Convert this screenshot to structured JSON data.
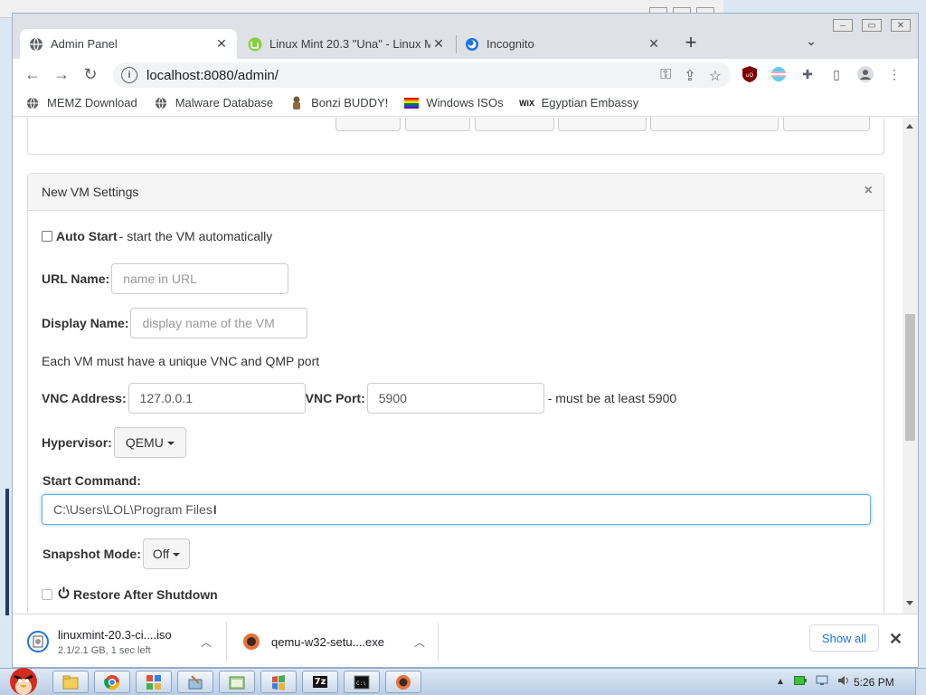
{
  "tabs": [
    {
      "title": "Admin Panel",
      "icon": "globe-icon",
      "active": true
    },
    {
      "title": "Linux Mint 20.3 \"Una\" - Linux M",
      "icon": "linux-mint-icon",
      "active": false
    },
    {
      "title": "Incognito",
      "icon": "incognito-icon",
      "active": false
    }
  ],
  "address_bar": {
    "url": "localhost:8080/admin/"
  },
  "bookmarks": [
    {
      "label": "MEMZ Download",
      "icon": "globe-icon"
    },
    {
      "label": "Malware Database",
      "icon": "globe-icon"
    },
    {
      "label": "Bonzi BUDDY!",
      "icon": "bonzi-icon"
    },
    {
      "label": "Windows ISOs",
      "icon": "rainbow-flag-icon"
    },
    {
      "label": "Egyptian Embassy",
      "icon": "wix-icon"
    }
  ],
  "panel": {
    "title": "New VM Settings",
    "close_glyph": "×",
    "autostart": {
      "label": "Auto Start",
      "desc": "- start the VM automatically",
      "checked": false
    },
    "url_name": {
      "label": "URL Name:",
      "placeholder": "name in URL",
      "value": ""
    },
    "display_name": {
      "label": "Display Name:",
      "placeholder": "display name of the VM",
      "value": ""
    },
    "port_note": "Each VM must have a unique VNC and QMP port",
    "vnc_address": {
      "label": "VNC Address:",
      "value": "127.0.0.1"
    },
    "vnc_port": {
      "label": "VNC Port:",
      "value": "5900",
      "note": "- must be at least 5900"
    },
    "hypervisor": {
      "label": "Hypervisor:",
      "value": "QEMU"
    },
    "start_command": {
      "label": "Start Command:",
      "value": "C:\\Users\\LOL\\Program Files"
    },
    "snapshot_mode": {
      "label": "Snapshot Mode:",
      "value": "Off"
    },
    "restore_after_shutdown": {
      "label": "Restore After Shutdown",
      "checked": false
    }
  },
  "downloads": [
    {
      "name": "linuxmint-20.3-ci....iso",
      "status": "2.1/2.1 GB, 1 sec left",
      "icon": "iso-file-icon"
    },
    {
      "name": "qemu-w32-setu....exe",
      "status": "",
      "icon": "qemu-icon"
    }
  ],
  "download_shelf": {
    "show_all_label": "Show all"
  },
  "taskbar": {
    "clock": "5:26 PM",
    "apps": [
      "folder-icon",
      "chrome-icon",
      "control-panel-icon",
      "paint-icon",
      "explorer-icon",
      "windows-media-icon",
      "7zip-icon",
      "cmd-icon",
      "qemu-icon"
    ]
  }
}
